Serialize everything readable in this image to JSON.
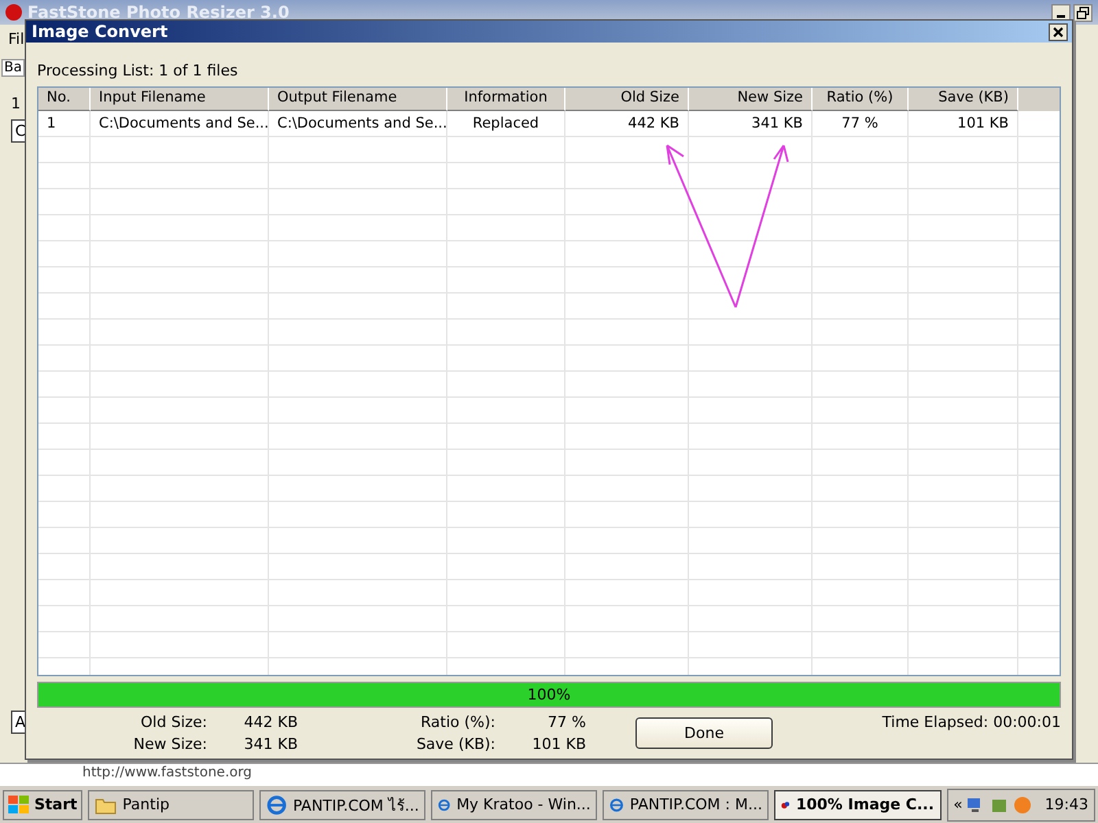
{
  "background_window": {
    "title": "FastStone Photo Resizer 3.0",
    "menu": "Fil",
    "tab": "Ba",
    "fragments": [
      "1",
      "C",
      "A"
    ],
    "footer_link": "http://www.faststone.org"
  },
  "dialog": {
    "title": "Image Convert",
    "processing": "Processing List: 1 of 1 files",
    "table": {
      "columns": [
        "No.",
        "Input Filename",
        "Output Filename",
        "Information",
        "Old Size",
        "New Size",
        "Ratio (%)",
        "Save (KB)"
      ],
      "rows": [
        [
          "1",
          "C:\\Documents and Se...",
          "C:\\Documents and Se...",
          "Replaced",
          "442 KB",
          "341 KB",
          "77 %",
          "101 KB"
        ]
      ]
    },
    "progress": {
      "level": 1,
      "label": "100%"
    },
    "stats": [
      {
        "label": "Old Size:",
        "value": "442 KB"
      },
      {
        "label": "New Size:",
        "value": "341 KB"
      },
      {
        "label": "Ratio (%):",
        "value": "77 %"
      },
      {
        "label": "Save (KB):",
        "value": "101 KB"
      }
    ],
    "done_button": "Done",
    "elapsed": "Time Elapsed: 00:00:01"
  },
  "taskbar": {
    "start": "Start",
    "items": [
      {
        "label": "Pantip",
        "kind": "folder",
        "selected": false
      },
      {
        "label": "PANTIP.COM ไร้...",
        "kind": "browser",
        "selected": false
      },
      {
        "label": "My Kratoo - Win...",
        "kind": "browser",
        "selected": false
      },
      {
        "label": "PANTIP.COM : M...",
        "kind": "browser",
        "selected": false
      },
      {
        "label": "100% Image C...",
        "kind": "app",
        "selected": true
      }
    ],
    "tray_toggle": "«",
    "clock": "19:43"
  }
}
